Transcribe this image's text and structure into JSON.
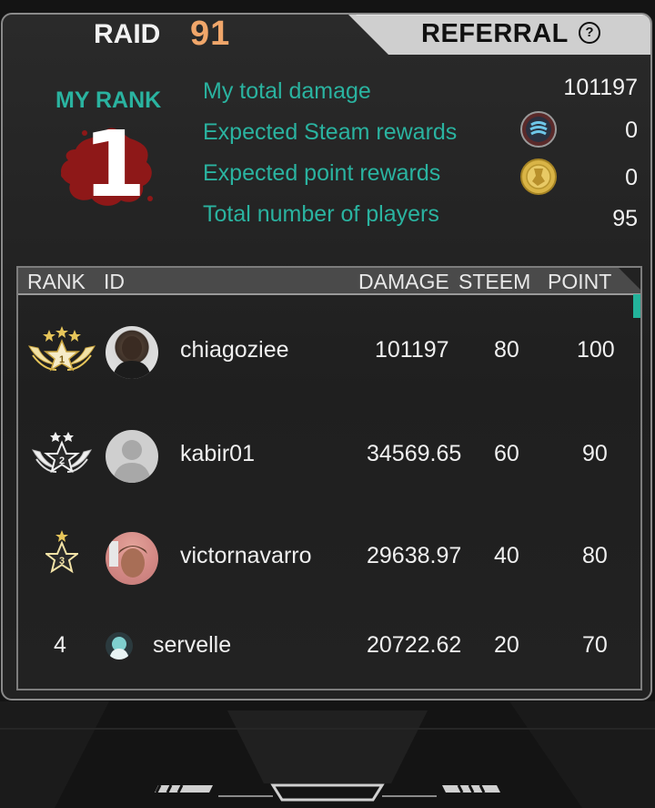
{
  "header": {
    "raid_label": "RAID",
    "raid_number": "91",
    "referral_label": "REFERRAL",
    "help_symbol": "?"
  },
  "my_rank": {
    "title": "MY RANK",
    "rank": "1"
  },
  "stats": [
    {
      "label": "My total damage",
      "value": "101197"
    },
    {
      "label": "Expected Steam rewards",
      "value": "0",
      "icon": "steem-coin-icon"
    },
    {
      "label": "Expected point rewards",
      "value": "0",
      "icon": "gold-point-coin-icon"
    },
    {
      "label": "Total number of players",
      "value": "95"
    }
  ],
  "table": {
    "headers": [
      "RANK",
      "ID",
      "DAMAGE",
      "STEEM",
      "POINT"
    ],
    "rows": [
      {
        "rank": "1",
        "id": "chiagoziee",
        "damage": "101197",
        "steem": "80",
        "point": "100"
      },
      {
        "rank": "2",
        "id": "kabir01",
        "damage": "34569.65",
        "steem": "60",
        "point": "90"
      },
      {
        "rank": "3",
        "id": "victornavarro",
        "damage": "29638.97",
        "steem": "40",
        "point": "80"
      },
      {
        "rank": "4",
        "id": "servelle",
        "damage": "20722.62",
        "steem": "20",
        "point": "70"
      }
    ]
  },
  "colors": {
    "accent_teal": "#2ab3a0",
    "raid_orange": "#f0a66a",
    "rank_red": "#8e1818",
    "gold": "#e6c55a"
  }
}
